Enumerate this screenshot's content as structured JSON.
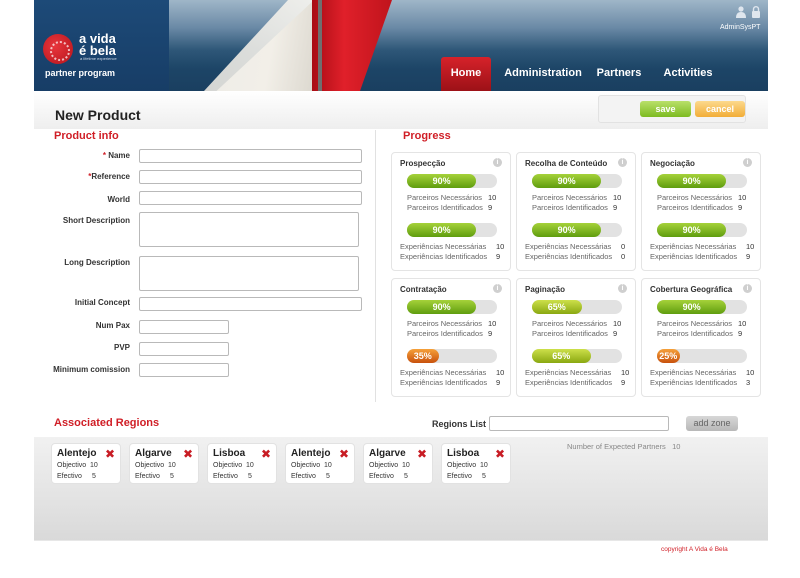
{
  "header": {
    "brand_name": "a vida é bela",
    "brand_tagline": "a lifetime experience",
    "program": "partner program",
    "user": "AdminSysPT",
    "nav": [
      "Home",
      "Administration",
      "Partners",
      "Activities"
    ]
  },
  "page_title": "New Product",
  "actions": {
    "save": "save",
    "cancel": "cancel"
  },
  "product_info": {
    "title": "Product info",
    "fields": {
      "name": "Name",
      "reference": "Reference",
      "world": "World",
      "short_description": "Short Description",
      "long_description": "Long Description",
      "initial_concept": "Initial Concept",
      "num_pax": "Num Pax",
      "pvp": "PVP",
      "minimum_comission": "Minimum comission"
    },
    "required_mark": "*"
  },
  "progress": {
    "title": "Progress",
    "stat_labels": [
      "Parceiros Necessários",
      "Parceiros Identificados",
      "Experiências Necessárias",
      "Experiências Identificados"
    ],
    "cards": [
      {
        "title": "Prospecção",
        "bar1": "90%",
        "bar1_value": 90,
        "pn": "10",
        "pi": "9",
        "bar2": "90%",
        "bar2_value": 90,
        "en": "10",
        "ei": "9"
      },
      {
        "title": "Recolha de Conteúdo",
        "bar1": "90%",
        "bar1_value": 90,
        "pn": "10",
        "pi": "9",
        "bar2": "90%",
        "bar2_value": 90,
        "en": "0",
        "ei": "0"
      },
      {
        "title": "Negociação",
        "bar1": "90%",
        "bar1_value": 90,
        "pn": "10",
        "pi": "9",
        "bar2": "90%",
        "bar2_value": 90,
        "en": "10",
        "ei": "9"
      },
      {
        "title": "Contratação",
        "bar1": "90%",
        "bar1_value": 90,
        "pn": "10",
        "pi": "9",
        "bar2": "35%",
        "bar2_value": 35,
        "en": "10",
        "ei": "9"
      },
      {
        "title": "Paginação",
        "bar1": "65%",
        "bar1_value": 65,
        "pn": "10",
        "pi": "9",
        "bar2": "65%",
        "bar2_value": 65,
        "en": "10",
        "ei": "9"
      },
      {
        "title": "Cobertura Geográfica",
        "bar1": "90%",
        "bar1_value": 90,
        "pn": "10",
        "pi": "9",
        "bar2": "25%",
        "bar2_value": 25,
        "en": "10",
        "ei": "3"
      }
    ]
  },
  "regions": {
    "title": "Associated Regions",
    "list_label": "Regions List",
    "add_zone": "add zone",
    "expected_partners_label": "Number of Expected Partners",
    "expected_partners": "10",
    "objective_label": "Objectivo",
    "effective_label": "Efectivo",
    "items": [
      {
        "name": "Alentejo",
        "objective": "10",
        "effective": "5"
      },
      {
        "name": "Algarve",
        "objective": "10",
        "effective": "5"
      },
      {
        "name": "Lisboa",
        "objective": "10",
        "effective": "5"
      },
      {
        "name": "Alentejo",
        "objective": "10",
        "effective": "5"
      },
      {
        "name": "Algarve",
        "objective": "10",
        "effective": "5"
      },
      {
        "name": "Lisboa",
        "objective": "10",
        "effective": "5"
      }
    ]
  },
  "footer": {
    "copyright": "copyright A Vida é Bela"
  },
  "colors": {
    "brand_red": "#d01e26",
    "green": "#7dbb21",
    "orange": "#f2ad38"
  }
}
